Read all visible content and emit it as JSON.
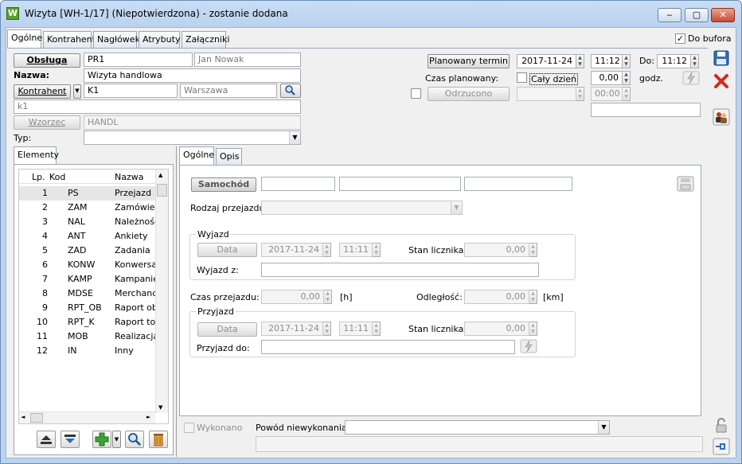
{
  "window": {
    "title": "Wizyta [WH-1/17] (Niepotwierdzona) - zostanie dodana",
    "app_icon_letter": "W",
    "minimize": "‒",
    "maximize": "▢",
    "close": "✕"
  },
  "tabs": [
    "Ogólne",
    "Kontrahent",
    "Nagłówek",
    "Atrybuty",
    "Załączniki"
  ],
  "do_bufora": {
    "label": "Do bufora",
    "checked": "✓"
  },
  "form": {
    "obsluga_button": "Obsługa",
    "obsluga_code": "PR1",
    "obsluga_name": "Jan  Nowak",
    "nazwa_label": "Nazwa:",
    "nazwa_value": "Wizyta handlowa",
    "kontrahent_button": "Kontrahent",
    "kontrahent_code": "K1",
    "kontrahent_city": "Warszawa",
    "kontrahent_name": "k1",
    "wzorzec_button": "Wzorzec",
    "wzorzec_value": "HANDL",
    "typ_label": "Typ:",
    "typ_value": ""
  },
  "schedule": {
    "planowany_termin_button": "Planowany termin",
    "date": "2017-11-24",
    "time_from": "11:12",
    "do_label": "Do:",
    "time_to": "11:12",
    "czas_planowany_label": "Czas planowany:",
    "caly_dzien_label": "Cały dzień",
    "czas_value": "0,00",
    "godz_label": "godz.",
    "odrzucono_button": "Odrzucono",
    "odrzucono_date": "",
    "odrzucono_time": "00:00",
    "extra_field": ""
  },
  "elements": {
    "tab_label": "Elementy",
    "columns": [
      "Lp.",
      "Kod",
      "Nazwa"
    ],
    "rows": [
      {
        "lp": "1",
        "kod": "PS",
        "nazwa": "Przejazd"
      },
      {
        "lp": "2",
        "kod": "ZAM",
        "nazwa": "Zamówienia"
      },
      {
        "lp": "3",
        "kod": "NAL",
        "nazwa": "Należności"
      },
      {
        "lp": "4",
        "kod": "ANT",
        "nazwa": "Ankiety"
      },
      {
        "lp": "5",
        "kod": "ZAD",
        "nazwa": "Zadania"
      },
      {
        "lp": "6",
        "kod": "KONW",
        "nazwa": "Konwersacje"
      },
      {
        "lp": "7",
        "kod": "KAMP",
        "nazwa": "Kampanie"
      },
      {
        "lp": "8",
        "kod": "MDSE",
        "nazwa": "Merchandising"
      },
      {
        "lp": "9",
        "kod": "RPT_OB",
        "nazwa": "Raport obecności"
      },
      {
        "lp": "10",
        "kod": "RPT_K",
        "nazwa": "Raport towarów"
      },
      {
        "lp": "11",
        "kod": "MOB",
        "nazwa": "Realizacja"
      },
      {
        "lp": "12",
        "kod": "IN",
        "nazwa": "Inny"
      }
    ]
  },
  "detail": {
    "tabs": [
      "Ogólne",
      "Opis"
    ],
    "samochod_button": "Samochód",
    "samochod_fields": [
      "",
      "",
      ""
    ],
    "rodzaj_label": "Rodzaj przejazdu:",
    "rodzaj_value": "",
    "wyjazd": {
      "legend": "Wyjazd",
      "data_button": "Data",
      "date": "2017-11-24",
      "time": "11:11",
      "stan_label": "Stan licznika:",
      "stan_value": "0,00",
      "place_label": "Wyjazd z:",
      "place_value": ""
    },
    "czas_przejazdu_label": "Czas przejazdu:",
    "czas_przejazdu_value": "0,00",
    "h_unit": "[h]",
    "odleglosc_label": "Odległość:",
    "odleglosc_value": "0,00",
    "km_unit": "[km]",
    "przyjazd": {
      "legend": "Przyjazd",
      "data_button": "Data",
      "date": "2017-11-24",
      "time": "11:11",
      "stan_label": "Stan licznika:",
      "stan_value": "0,00",
      "place_label": "Przyjazd do:",
      "place_value": ""
    }
  },
  "footer": {
    "wykonano_label": "Wykonano",
    "powod_label": "Powód niewykonania:",
    "powod_value": "",
    "notes": ""
  },
  "colors": {
    "accent": "#bcd3ef",
    "save": "#2f6fb8",
    "cancel": "#d22a1e"
  }
}
